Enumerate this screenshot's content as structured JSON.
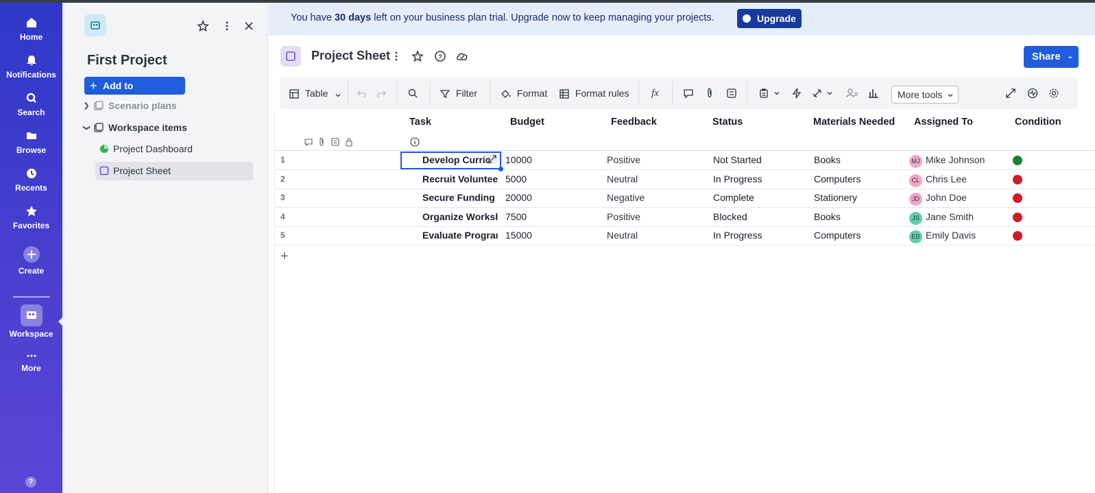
{
  "rail": {
    "items": [
      {
        "label": "Home",
        "icon": "home-icon"
      },
      {
        "label": "Notifications",
        "icon": "bell-icon"
      },
      {
        "label": "Search",
        "icon": "search-icon"
      },
      {
        "label": "Browse",
        "icon": "folder-icon"
      },
      {
        "label": "Recents",
        "icon": "clock-icon"
      },
      {
        "label": "Favorites",
        "icon": "star-icon"
      },
      {
        "label": "Create",
        "icon": "plus-circle-icon"
      },
      {
        "label": "Workspace",
        "icon": "workspace-icon"
      },
      {
        "label": "More",
        "icon": "more-dots-icon"
      }
    ],
    "help": "?"
  },
  "panel": {
    "title": "First Project",
    "add_button": "Add to workspace",
    "tree": {
      "scenario": "Scenario plans",
      "workspace_items": "Workspace items",
      "dashboard": "Project Dashboard",
      "sheet": "Project Sheet"
    }
  },
  "banner": {
    "pre": "You have ",
    "days": "30 days",
    "post": " left on your business plan trial. Upgrade now to keep managing your projects.",
    "upgrade": "Upgrade"
  },
  "header": {
    "title": "Project Sheet",
    "share": "Share"
  },
  "toolbar": {
    "view": "Table",
    "filter": "Filter",
    "format": "Format",
    "format_rules": "Format rules",
    "more_tools": "More tools"
  },
  "table": {
    "columns": [
      "Task",
      "Budget",
      "Feedback",
      "Status",
      "Materials Needed",
      "Assigned To",
      "Condition"
    ],
    "rows": [
      {
        "num": "1",
        "task": "Develop Curric",
        "budget": "10000",
        "feedback": "Positive",
        "status": "Not Started",
        "materials": "Books",
        "initials": "MJ",
        "assigned": "Mike Johnson",
        "avatar_color": "#f2a7c8",
        "condition_color": "#1e7e34"
      },
      {
        "num": "2",
        "task": "Recruit Voluntee",
        "budget": "5000",
        "feedback": "Neutral",
        "status": "In Progress",
        "materials": "Computers",
        "initials": "CL",
        "assigned": "Chris Lee",
        "avatar_color": "#f2a7c8",
        "condition_color": "#d11a2a"
      },
      {
        "num": "3",
        "task": "Secure Funding",
        "budget": "20000",
        "feedback": "Negative",
        "status": "Complete",
        "materials": "Stationery",
        "initials": "JD",
        "assigned": "John Doe",
        "avatar_color": "#f2a7c8",
        "condition_color": "#d11a2a"
      },
      {
        "num": "4",
        "task": "Organize Worksh",
        "budget": "7500",
        "feedback": "Positive",
        "status": "Blocked",
        "materials": "Books",
        "initials": "JS",
        "assigned": "Jane Smith",
        "avatar_color": "#5fcfb0",
        "condition_color": "#d11a2a"
      },
      {
        "num": "5",
        "task": "Evaluate Progran",
        "budget": "15000",
        "feedback": "Neutral",
        "status": "In Progress",
        "materials": "Computers",
        "initials": "ED",
        "assigned": "Emily Davis",
        "avatar_color": "#5fcfb0",
        "condition_color": "#d11a2a"
      }
    ],
    "add_row": "+"
  }
}
